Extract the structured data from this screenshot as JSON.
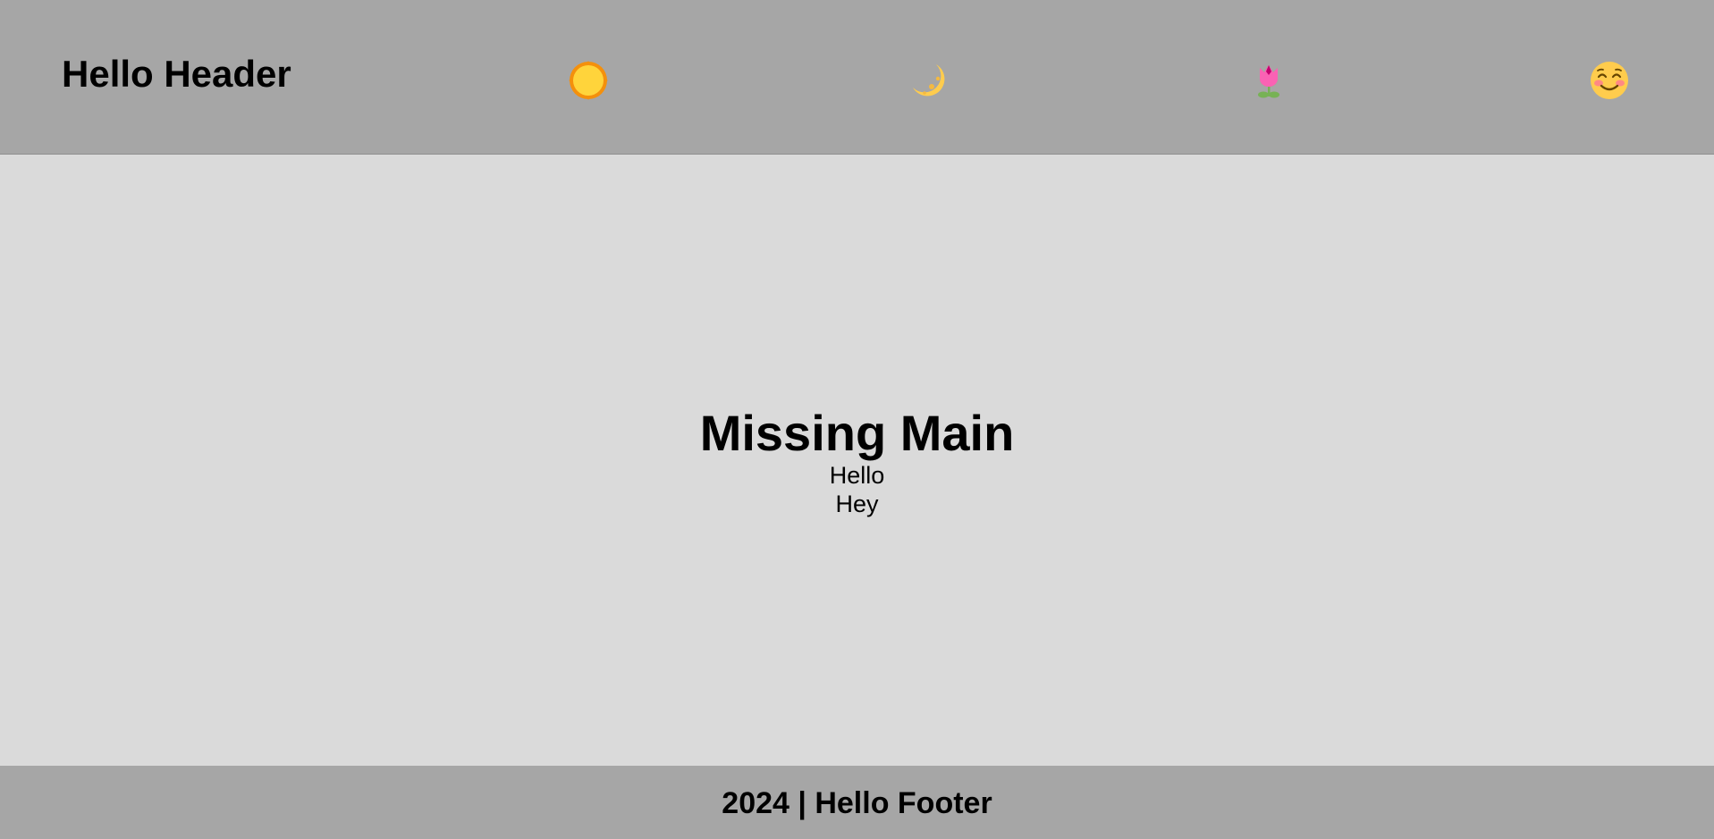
{
  "header": {
    "title": "Hello Header",
    "icons": [
      "sun-icon",
      "crescent-moon-icon",
      "tulip-icon",
      "smiling-face-icon"
    ]
  },
  "main": {
    "title": "Missing Main",
    "lines": [
      "Hello",
      "Hey"
    ]
  },
  "footer": {
    "text": "2024 | Hello Footer"
  },
  "colors": {
    "header_bg": "#a6a6a6",
    "main_bg": "#dadada",
    "footer_bg": "#a6a6a6"
  }
}
